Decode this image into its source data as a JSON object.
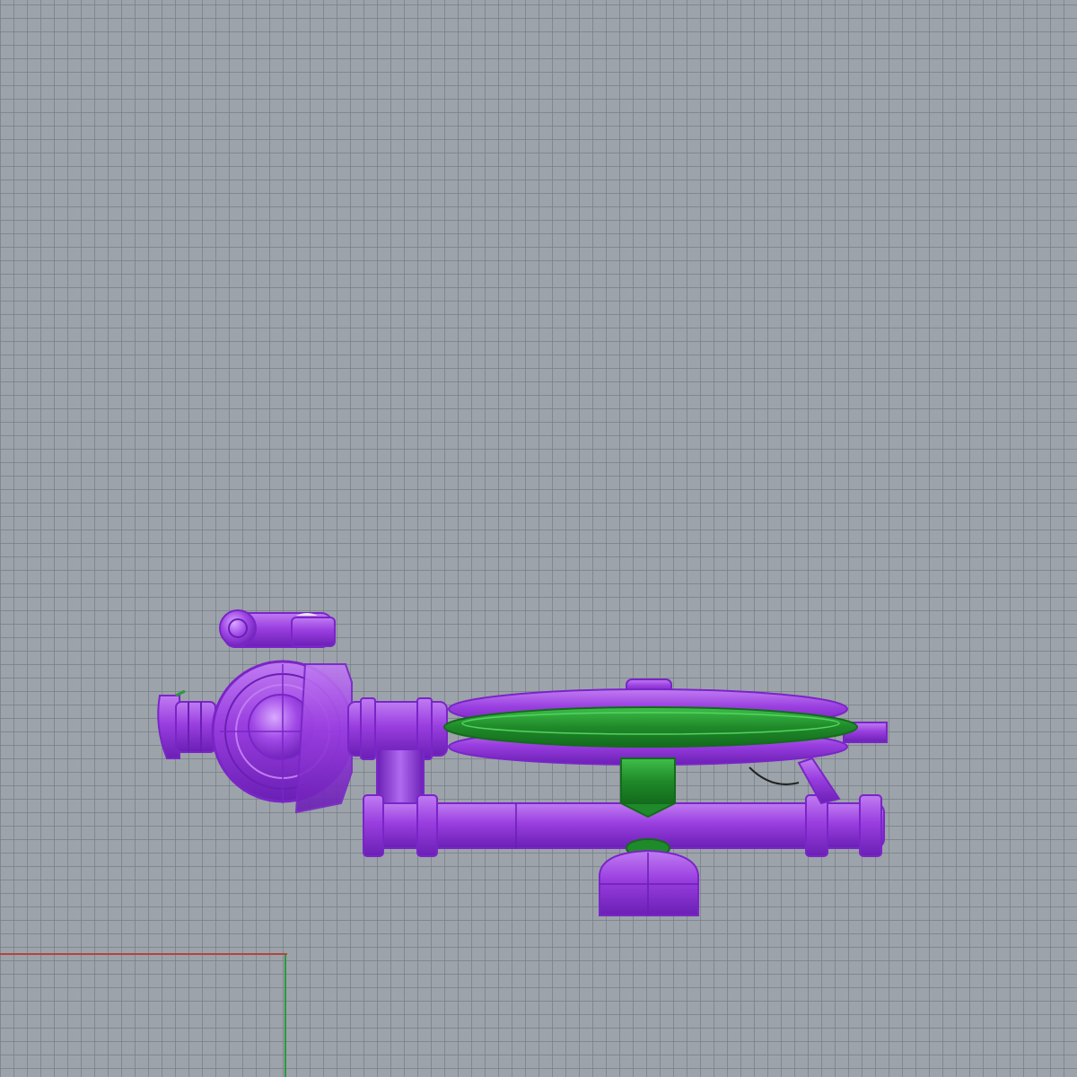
{
  "viewport": {
    "view": "Top",
    "display_mode": "shaded",
    "grid": true,
    "background_color": "#9ca3aa",
    "grid_color": "#7c838b"
  },
  "axes": {
    "x_axis_color": "#b3443e",
    "y_axis_color": "#2a9a3c"
  },
  "model": {
    "selected_color": "#9a3ee0",
    "selected_highlight": "#c07cf2",
    "selected_shadow": "#6a1fb4",
    "unselected_color": "#1f8a2a",
    "unselected_highlight": "#3fbf4a",
    "parts": [
      {
        "name": "eyepiece-assembly",
        "selected": true
      },
      {
        "name": "round-housing",
        "selected": true
      },
      {
        "name": "front-nozzle",
        "selected": true
      },
      {
        "name": "upper-connector",
        "selected": true
      },
      {
        "name": "vertical-tube",
        "selected": true
      },
      {
        "name": "lower-pipe",
        "selected": true
      },
      {
        "name": "disc-platform",
        "selected": true
      },
      {
        "name": "green-ring",
        "selected": false
      },
      {
        "name": "green-post",
        "selected": false
      },
      {
        "name": "base-foot",
        "selected": true
      }
    ]
  }
}
